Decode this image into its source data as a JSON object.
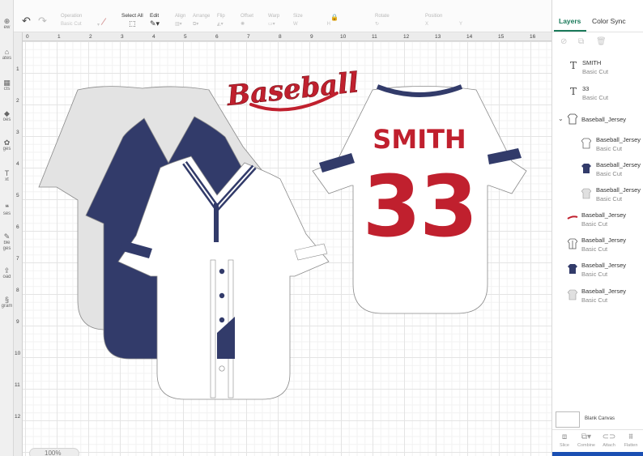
{
  "left_strip": {
    "items": [
      {
        "label": "ew",
        "icon": "new-icon"
      },
      {
        "label": "ates",
        "icon": "templates-icon"
      },
      {
        "label": "cts",
        "icon": "projects-icon"
      },
      {
        "label": "oes",
        "icon": "shapes-icon"
      },
      {
        "label": "ges",
        "icon": "images-icon"
      },
      {
        "label": "xt",
        "icon": "text-icon"
      },
      {
        "label": "ses",
        "icon": "phrases-icon"
      },
      {
        "label": "ble",
        "icon": "editable-images-icon"
      },
      {
        "label": "ges",
        "icon": "editable-images-icon"
      },
      {
        "label": "oad",
        "icon": "upload-icon"
      },
      {
        "label": "gram",
        "icon": "monogram-icon"
      }
    ]
  },
  "toolbar": {
    "operation": {
      "label": "Operation",
      "value": "Basic Cut"
    },
    "select_all": "Select All",
    "edit": "Edit",
    "align": "Align",
    "arrange": "Arrange",
    "flip": "Flip",
    "offset": "Offset",
    "warp": "Warp",
    "size": {
      "label": "Size",
      "w": "W",
      "h": "H"
    },
    "rotate": "Rotate",
    "position": {
      "label": "Position",
      "x": "X",
      "y": "Y"
    }
  },
  "ruler": {
    "top": [
      "0",
      "1",
      "2",
      "3",
      "4",
      "5",
      "6",
      "7",
      "8",
      "9",
      "10",
      "11",
      "12",
      "13",
      "14",
      "15",
      "16"
    ],
    "left": [
      "1",
      "2",
      "3",
      "4",
      "5",
      "6",
      "7",
      "8",
      "9",
      "10",
      "11",
      "12"
    ]
  },
  "zoom": "100%",
  "canvas_art": {
    "title_text": "Baseball",
    "name_text": "SMITH",
    "number_text": "33",
    "colors": {
      "navy": "#323b6a",
      "red": "#c0202e",
      "gray": "#e3e3e3",
      "white": "#ffffff",
      "outline": "#8a8a8a"
    }
  },
  "layers_panel": {
    "tabs": [
      "Layers",
      "Color Sync"
    ],
    "layers": [
      {
        "name": "SMITH",
        "sub": "Basic Cut",
        "icon": "text-layer-icon"
      },
      {
        "name": "33",
        "sub": "Basic Cut",
        "icon": "text-layer-icon"
      },
      {
        "name": "Baseball_Jersey",
        "sub": "",
        "icon": "group-jersey-icon"
      },
      {
        "name": "Baseball_Jersey",
        "sub": "Basic Cut",
        "icon": "jersey-outline-icon"
      },
      {
        "name": "Baseball_Jersey",
        "sub": "Basic Cut",
        "icon": "jersey-navy-icon"
      },
      {
        "name": "Baseball_Jersey",
        "sub": "Basic Cut",
        "icon": "jersey-gray-icon"
      },
      {
        "name": "Baseball_Jersey",
        "sub": "Basic Cut",
        "icon": "baseball-text-icon"
      },
      {
        "name": "Baseball_Jersey",
        "sub": "Basic Cut",
        "icon": "jersey-striped-icon"
      },
      {
        "name": "Baseball_Jersey",
        "sub": "Basic Cut",
        "icon": "jersey-navy-icon"
      },
      {
        "name": "Baseball_Jersey",
        "sub": "Basic Cut",
        "icon": "jersey-gray-icon"
      }
    ],
    "blank_canvas": "Blank Canvas",
    "bottom_actions": [
      {
        "label": "Slice",
        "icon": "slice-icon"
      },
      {
        "label": "Combine",
        "icon": "combine-icon"
      },
      {
        "label": "Attach",
        "icon": "attach-icon"
      },
      {
        "label": "Flatten",
        "icon": "flatten-icon"
      }
    ]
  }
}
